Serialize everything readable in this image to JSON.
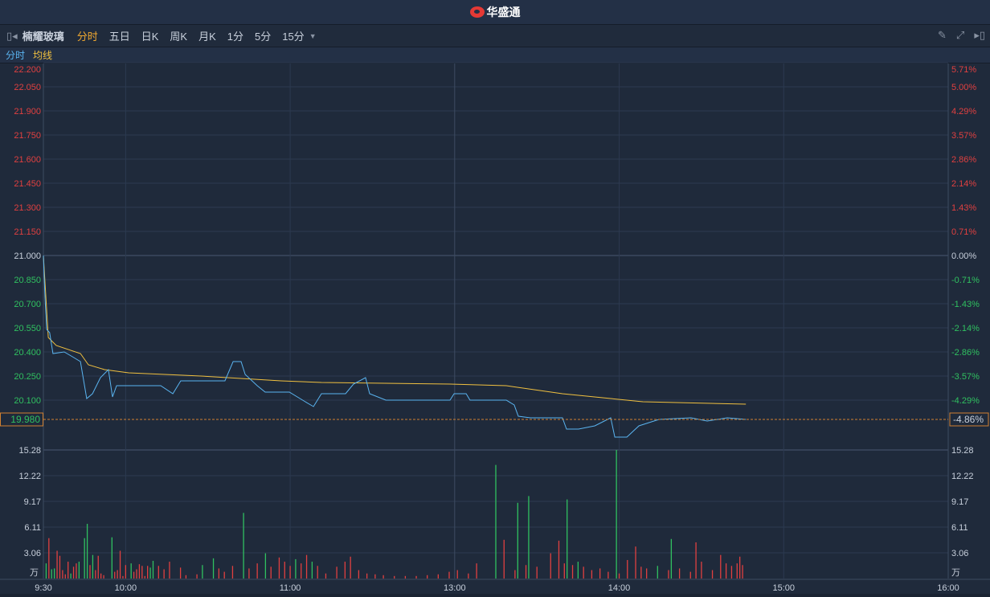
{
  "app": {
    "brand": "华盛通"
  },
  "toolbar": {
    "stock_name": "楠耀玻璃",
    "tabs": [
      "分时",
      "五日",
      "日K",
      "周K",
      "月K",
      "1分",
      "5分",
      "15分"
    ],
    "active": "分时",
    "icons": [
      "collapse-left-icon",
      "pencil-icon",
      "fullscreen-icon",
      "collapse-right-icon"
    ]
  },
  "legend": {
    "price_label": "分时",
    "avg_label": "均线"
  },
  "colors": {
    "price": "#5ab4f0",
    "avg": "#f0c040",
    "up": "#e04040",
    "down": "#30c060"
  },
  "chart_data": {
    "type": "line",
    "prev_close": 21.0,
    "current_price": "19.980",
    "current_change": "-4.86%",
    "price_ticks": [
      "22.200",
      "22.050",
      "21.900",
      "21.750",
      "21.600",
      "21.450",
      "21.300",
      "21.150",
      "21.000",
      "20.850",
      "20.700",
      "20.550",
      "20.400",
      "20.250",
      "20.100"
    ],
    "pct_ticks": [
      "5.71%",
      "5.00%",
      "4.29%",
      "3.57%",
      "2.86%",
      "2.14%",
      "1.43%",
      "0.71%",
      "0.00%",
      "-0.71%",
      "-1.43%",
      "-2.14%",
      "-2.86%",
      "-3.57%",
      "-4.29%"
    ],
    "ylim": [
      19.8,
      22.2
    ],
    "vol_ticks": [
      "15.28",
      "12.22",
      "9.17",
      "6.11",
      "3.06"
    ],
    "vol_unit": "万",
    "vol_max": 15.28,
    "time_labels": [
      "9:30",
      "10:00",
      "11:00",
      "13:00",
      "14:00",
      "15:00",
      "16:00"
    ],
    "total_minutes": 330,
    "price_series": [
      [
        0,
        21.0
      ],
      [
        0.6,
        20.74
      ],
      [
        1.2,
        20.54
      ],
      [
        2.3,
        20.52
      ],
      [
        3.5,
        20.39
      ],
      [
        7.6,
        20.4
      ],
      [
        10.6,
        20.37
      ],
      [
        13.5,
        20.34
      ],
      [
        15.8,
        20.11
      ],
      [
        17.9,
        20.14
      ],
      [
        20.8,
        20.24
      ],
      [
        23.7,
        20.29
      ],
      [
        25.2,
        20.12
      ],
      [
        26.7,
        20.19
      ],
      [
        42.8,
        20.19
      ],
      [
        47.2,
        20.14
      ],
      [
        50.1,
        20.22
      ],
      [
        66.2,
        20.22
      ],
      [
        69.2,
        20.34
      ],
      [
        72.1,
        20.34
      ],
      [
        73.6,
        20.26
      ],
      [
        78,
        20.19
      ],
      [
        80.9,
        20.15
      ],
      [
        89.7,
        20.15
      ],
      [
        95.5,
        20.09
      ],
      [
        98.5,
        20.06
      ],
      [
        101.4,
        20.14
      ],
      [
        110.2,
        20.14
      ],
      [
        113.1,
        20.2
      ],
      [
        117.5,
        20.24
      ],
      [
        119,
        20.14
      ],
      [
        124.9,
        20.1
      ],
      [
        148.3,
        20.1
      ],
      [
        149.8,
        20.14
      ],
      [
        154.2,
        20.14
      ],
      [
        155.6,
        20.1
      ],
      [
        168.8,
        20.1
      ],
      [
        171.7,
        20.07
      ],
      [
        173.2,
        20.0
      ],
      [
        177.6,
        19.99
      ],
      [
        189.3,
        19.99
      ],
      [
        190.8,
        19.92
      ],
      [
        195.2,
        19.92
      ],
      [
        201.1,
        19.94
      ],
      [
        206.9,
        19.99
      ],
      [
        208.4,
        19.87
      ],
      [
        212.8,
        19.87
      ],
      [
        217.2,
        19.94
      ],
      [
        224.5,
        19.98
      ],
      [
        236.2,
        19.99
      ],
      [
        242.1,
        19.97
      ],
      [
        249.4,
        19.99
      ],
      [
        256.2,
        19.98
      ]
    ],
    "avg_series": [
      [
        0,
        21.0
      ],
      [
        1.8,
        20.49
      ],
      [
        4.7,
        20.44
      ],
      [
        13.5,
        20.39
      ],
      [
        16.4,
        20.32
      ],
      [
        22.3,
        20.29
      ],
      [
        31.1,
        20.27
      ],
      [
        57.4,
        20.25
      ],
      [
        86.7,
        20.22
      ],
      [
        101.4,
        20.21
      ],
      [
        148.3,
        20.2
      ],
      [
        168.8,
        20.19
      ],
      [
        189.3,
        20.14
      ],
      [
        206.9,
        20.11
      ],
      [
        218.6,
        20.09
      ],
      [
        256.2,
        20.075
      ]
    ],
    "volume": [
      [
        1,
        1.8,
        "g"
      ],
      [
        2,
        4.8,
        "r"
      ],
      [
        3,
        1.1,
        "g"
      ],
      [
        4,
        1.2,
        "g"
      ],
      [
        5,
        3.3,
        "r"
      ],
      [
        6,
        2.7,
        "r"
      ],
      [
        7,
        1.0,
        "r"
      ],
      [
        8,
        0.5,
        "r"
      ],
      [
        9,
        2.0,
        "r"
      ],
      [
        10,
        0.6,
        "g"
      ],
      [
        11,
        1.4,
        "r"
      ],
      [
        12,
        1.8,
        "r"
      ],
      [
        13,
        2.0,
        "g"
      ],
      [
        15,
        4.8,
        "g"
      ],
      [
        16,
        6.5,
        "g"
      ],
      [
        17,
        1.6,
        "r"
      ],
      [
        18,
        2.8,
        "g"
      ],
      [
        19,
        1.0,
        "r"
      ],
      [
        20,
        2.7,
        "r"
      ],
      [
        21,
        0.6,
        "r"
      ],
      [
        22,
        0.4,
        "r"
      ],
      [
        25,
        4.9,
        "g"
      ],
      [
        26,
        0.8,
        "r"
      ],
      [
        27,
        1.0,
        "r"
      ],
      [
        28,
        3.3,
        "r"
      ],
      [
        29,
        0.3,
        "r"
      ],
      [
        30,
        1.6,
        "r"
      ],
      [
        32,
        1.8,
        "g"
      ],
      [
        33,
        0.8,
        "r"
      ],
      [
        34,
        1.1,
        "r"
      ],
      [
        35,
        1.7,
        "r"
      ],
      [
        36,
        1.5,
        "r"
      ],
      [
        37,
        0.3,
        "r"
      ],
      [
        38,
        1.5,
        "r"
      ],
      [
        39,
        1.3,
        "g"
      ],
      [
        40,
        2.1,
        "g"
      ],
      [
        42,
        1.5,
        "r"
      ],
      [
        44,
        1.1,
        "r"
      ],
      [
        46,
        2.0,
        "r"
      ],
      [
        50,
        1.3,
        "r"
      ],
      [
        52,
        0.4,
        "r"
      ],
      [
        56,
        0.5,
        "r"
      ],
      [
        58,
        1.6,
        "g"
      ],
      [
        62,
        2.4,
        "g"
      ],
      [
        64,
        1.2,
        "r"
      ],
      [
        66,
        0.8,
        "r"
      ],
      [
        69,
        1.5,
        "r"
      ],
      [
        73,
        7.8,
        "g"
      ],
      [
        75,
        1.2,
        "r"
      ],
      [
        78,
        1.8,
        "r"
      ],
      [
        81,
        3.0,
        "g"
      ],
      [
        83,
        1.4,
        "r"
      ],
      [
        86,
        2.5,
        "r"
      ],
      [
        88,
        2.0,
        "r"
      ],
      [
        90,
        1.5,
        "r"
      ],
      [
        92,
        2.3,
        "g"
      ],
      [
        94,
        1.8,
        "r"
      ],
      [
        96,
        2.8,
        "r"
      ],
      [
        98,
        2.0,
        "g"
      ],
      [
        100,
        1.5,
        "r"
      ],
      [
        103,
        0.6,
        "r"
      ],
      [
        107,
        1.4,
        "r"
      ],
      [
        110,
        2.0,
        "r"
      ],
      [
        112,
        2.6,
        "r"
      ],
      [
        115,
        1.0,
        "r"
      ],
      [
        118,
        0.6,
        "r"
      ],
      [
        121,
        0.5,
        "r"
      ],
      [
        124,
        0.4,
        "r"
      ],
      [
        128,
        0.3,
        "r"
      ],
      [
        132,
        0.3,
        "r"
      ],
      [
        136,
        0.3,
        "r"
      ],
      [
        140,
        0.4,
        "r"
      ],
      [
        144,
        0.5,
        "r"
      ],
      [
        148,
        0.8,
        "r"
      ],
      [
        151,
        1.0,
        "r"
      ],
      [
        155,
        0.6,
        "r"
      ],
      [
        158,
        1.8,
        "r"
      ],
      [
        165,
        13.5,
        "g"
      ],
      [
        168,
        4.6,
        "r"
      ],
      [
        172,
        1.0,
        "r"
      ],
      [
        173,
        9.0,
        "g"
      ],
      [
        176,
        1.6,
        "r"
      ],
      [
        177,
        9.8,
        "g"
      ],
      [
        180,
        1.4,
        "r"
      ],
      [
        185,
        3.0,
        "r"
      ],
      [
        188,
        4.5,
        "r"
      ],
      [
        190,
        1.8,
        "r"
      ],
      [
        191,
        9.4,
        "g"
      ],
      [
        193,
        1.6,
        "r"
      ],
      [
        195,
        2.0,
        "g"
      ],
      [
        197,
        1.4,
        "r"
      ],
      [
        200,
        1.0,
        "r"
      ],
      [
        203,
        1.2,
        "r"
      ],
      [
        206,
        0.8,
        "r"
      ],
      [
        209,
        15.28,
        "g"
      ],
      [
        210,
        0.6,
        "r"
      ],
      [
        213,
        2.2,
        "r"
      ],
      [
        216,
        3.8,
        "r"
      ],
      [
        218,
        1.4,
        "r"
      ],
      [
        220,
        1.2,
        "r"
      ],
      [
        224,
        1.5,
        "g"
      ],
      [
        228,
        1.0,
        "r"
      ],
      [
        229,
        4.7,
        "g"
      ],
      [
        232,
        1.2,
        "r"
      ],
      [
        236,
        0.8,
        "r"
      ],
      [
        238,
        4.3,
        "r"
      ],
      [
        240,
        2.0,
        "r"
      ],
      [
        244,
        1.0,
        "r"
      ],
      [
        247,
        2.8,
        "r"
      ],
      [
        249,
        1.8,
        "r"
      ],
      [
        251,
        1.5,
        "r"
      ],
      [
        253,
        1.8,
        "r"
      ],
      [
        254,
        2.6,
        "r"
      ],
      [
        255,
        1.6,
        "r"
      ]
    ]
  }
}
